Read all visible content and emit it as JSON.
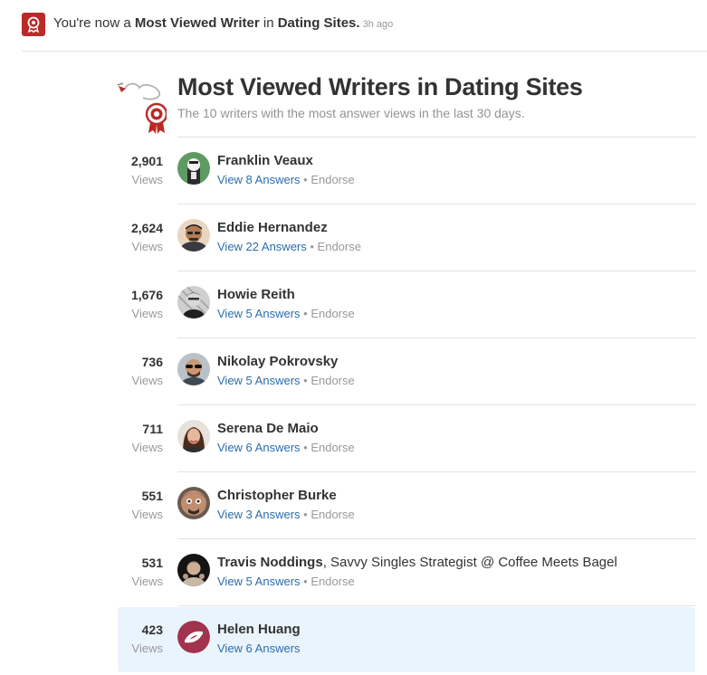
{
  "notification": {
    "prefix": "You're now a ",
    "badge": "Most Viewed Writer",
    "middle": " in ",
    "topic": "Dating Sites.",
    "time": "3h ago"
  },
  "header": {
    "title": "Most Viewed Writers in Dating Sites",
    "subtitle": "The 10 writers with the most answer views in the last 30 days."
  },
  "views_label": "Views",
  "endorse_label": "Endorse",
  "writers": [
    {
      "count": "2,901",
      "name": "Franklin Veaux",
      "credential": "",
      "answers": "View 8 Answers",
      "endorse": true
    },
    {
      "count": "2,624",
      "name": "Eddie Hernandez",
      "credential": "",
      "answers": "View 22 Answers",
      "endorse": true
    },
    {
      "count": "1,676",
      "name": "Howie Reith",
      "credential": "",
      "answers": "View 5 Answers",
      "endorse": true
    },
    {
      "count": "736",
      "name": "Nikolay Pokrovsky",
      "credential": "",
      "answers": "View 5 Answers",
      "endorse": true
    },
    {
      "count": "711",
      "name": "Serena De Maio",
      "credential": "",
      "answers": "View 6 Answers",
      "endorse": true
    },
    {
      "count": "551",
      "name": "Christopher Burke",
      "credential": "",
      "answers": "View 3 Answers",
      "endorse": true
    },
    {
      "count": "531",
      "name": "Travis Noddings",
      "credential": ", Savvy Singles Strategist @ Coffee Meets Bagel",
      "answers": "View 5 Answers",
      "endorse": true
    },
    {
      "count": "423",
      "name": "Helen Huang",
      "credential": "",
      "answers": "View 6 Answers",
      "endorse": false
    }
  ],
  "colors": {
    "brand_red": "#b92b27",
    "link_blue": "#2b6dad",
    "highlight": "#eaf4fd"
  }
}
